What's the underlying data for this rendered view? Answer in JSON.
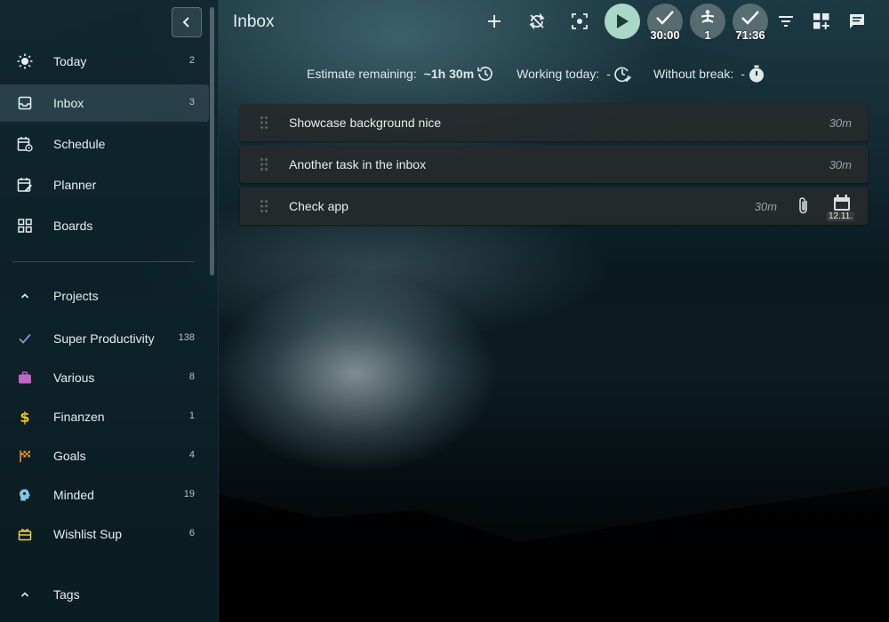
{
  "sidebar": {
    "collapse_icon": "chevron-left-icon",
    "main_items": [
      {
        "label": "Today",
        "count": "2",
        "icon": "sun-icon"
      },
      {
        "label": "Inbox",
        "count": "3",
        "icon": "inbox-icon",
        "active": true
      },
      {
        "label": "Schedule",
        "icon": "calendar-clock-icon"
      },
      {
        "label": "Planner",
        "icon": "calendar-edit-icon"
      },
      {
        "label": "Boards",
        "icon": "grid-icon"
      }
    ],
    "projects_label": "Projects",
    "projects": [
      {
        "label": "Super Productivity",
        "count": "138",
        "icon": "check-icon",
        "color": "#6fa3d8"
      },
      {
        "label": "Various",
        "count": "8",
        "icon": "briefcase-icon",
        "color": "#c264c8"
      },
      {
        "label": "Finanzen",
        "count": "1",
        "icon": "dollar-icon",
        "color": "#f0c020"
      },
      {
        "label": "Goals",
        "count": "4",
        "icon": "checkered-flag-icon",
        "color": "#e09a30"
      },
      {
        "label": "Minded",
        "count": "19",
        "icon": "brain-icon",
        "color": "#7fc8e0"
      },
      {
        "label": "Wishlist Sup",
        "count": "6",
        "icon": "gift-box-icon",
        "color": "#e8d040"
      }
    ],
    "tags_label": "Tags"
  },
  "header": {
    "title": "Inbox",
    "focus_timer": "30:00",
    "break_count": "1",
    "tracked_time": "71:36"
  },
  "stats": {
    "estimate_label": "Estimate remaining:",
    "estimate_value": "~1h 30m",
    "working_label": "Working today:",
    "working_value": "-",
    "break_label": "Without break:",
    "break_value": "-"
  },
  "tasks": [
    {
      "title": "Showcase background nice",
      "estimate": "30m"
    },
    {
      "title": "Another task in the inbox",
      "estimate": "30m"
    },
    {
      "title": "Check app",
      "estimate": "30m",
      "due": "12.11."
    }
  ],
  "colors": {
    "accent_play": "#a9d8c6",
    "sidebar_bg": "#0e222a",
    "task_bg": "#26292b"
  }
}
